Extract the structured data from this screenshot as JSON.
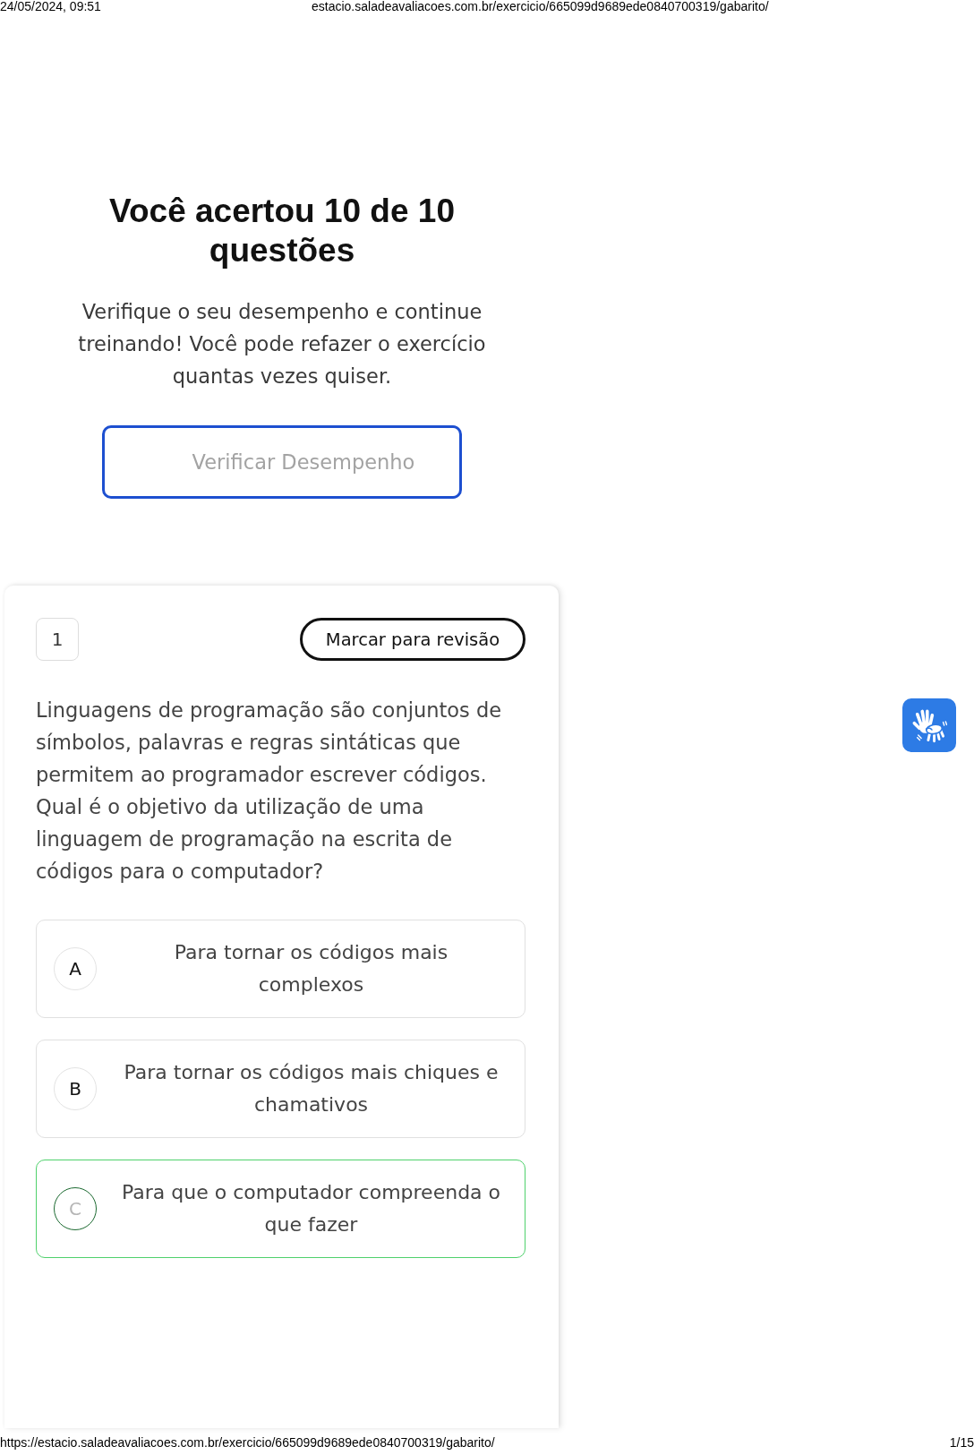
{
  "browser_header": {
    "date_time": "24/05/2024, 09:51",
    "page_address": "estacio.saladeavaliacoes.com.br/exercicio/665099d9689ede0840700319/gabarito/"
  },
  "result": {
    "title": "Você acertou 10 de 10 questões",
    "message": "Verifique o seu desempenho e continue treinando! Você pode refazer o exercício quantas vezes quiser.",
    "button": "Verificar Desempenho"
  },
  "question": {
    "number": "1",
    "review_button": "Marcar para revisão",
    "text": "Linguagens de programação são conjuntos de símbolos, palavras e regras sintáticas que permitem ao programador escrever códigos. Qual é o objetivo da utilização de uma linguagem de programação na escrita de códigos para o computador?",
    "options": [
      {
        "letter": "A",
        "text": "Para tornar os códigos mais complexos",
        "selected": false
      },
      {
        "letter": "B",
        "text": "Para tornar os códigos mais chiques e chamativos",
        "selected": false
      },
      {
        "letter": "C",
        "text": "Para que o computador compreenda o que fazer",
        "selected": true
      }
    ]
  },
  "footer": {
    "url": "https://estacio.saladeavaliacoes.com.br/exercicio/665099d9689ede0840700319/gabarito/",
    "page": "1/15"
  }
}
